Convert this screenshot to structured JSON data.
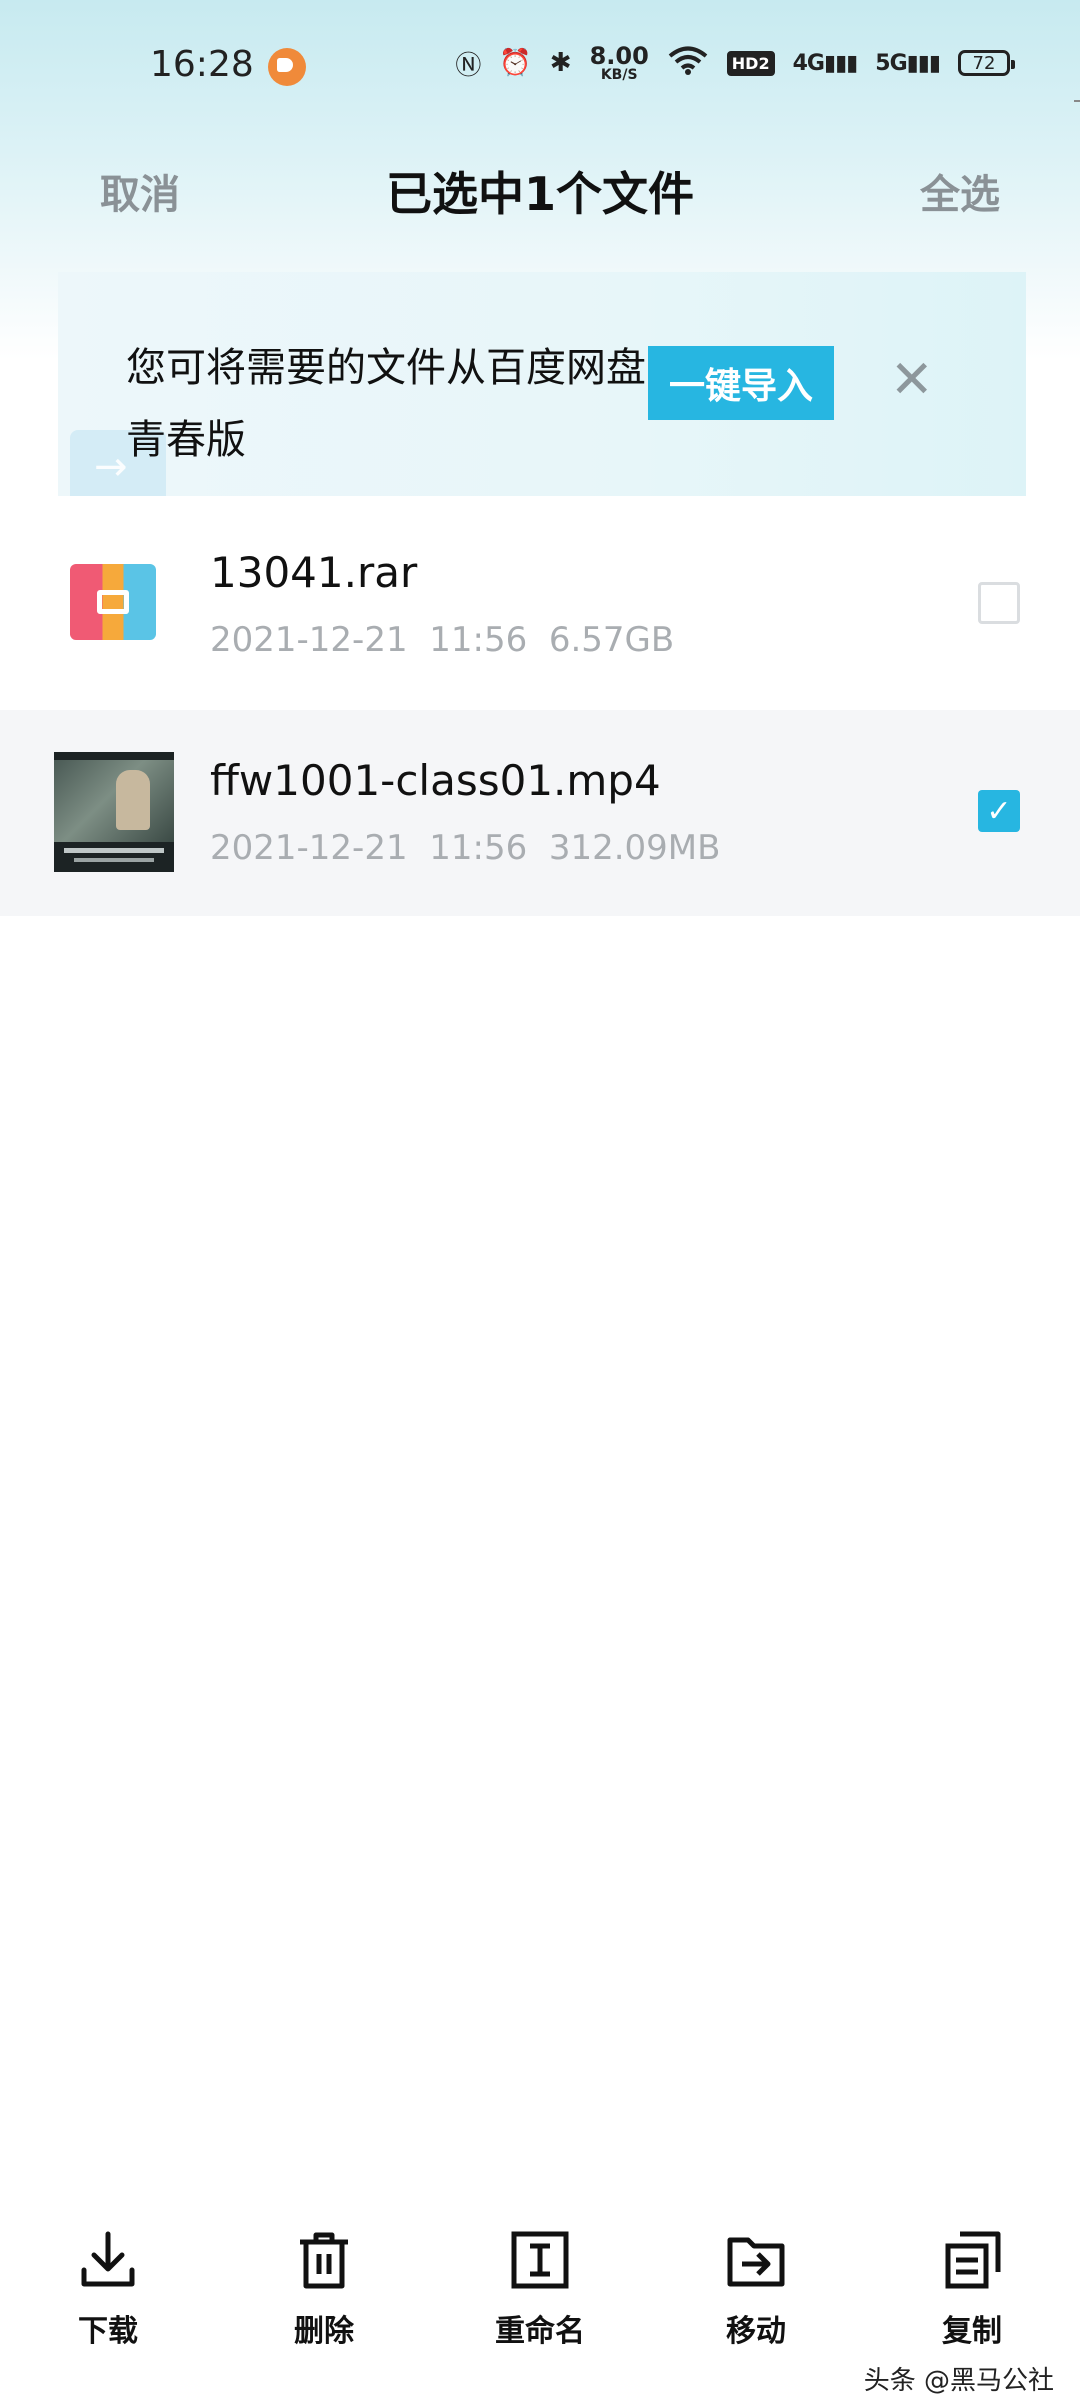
{
  "status_bar": {
    "time": "16:28",
    "net_speed_value": "8.00",
    "net_speed_unit": "KB/S",
    "hd_label": "HD2",
    "signal_1": "4G",
    "signal_2": "5G",
    "battery": "72",
    "icons": [
      "app-notification-icon",
      "nfc-icon",
      "alarm-icon",
      "bluetooth-icon",
      "wifi-icon",
      "signal-icon",
      "battery-icon"
    ]
  },
  "header": {
    "cancel_label": "取消",
    "title": "已选中1个文件",
    "select_all_label": "全选"
  },
  "banner": {
    "text": "您可将需要的文件从百度网盘导入青春版",
    "button_label": "一键导入",
    "close_icon": "close-icon"
  },
  "files": [
    {
      "name": "13041.rar",
      "date": "2021-12-21",
      "time": "11:56",
      "size": "6.57GB",
      "selected": false,
      "icon": "rar-archive-icon"
    },
    {
      "name": "ffw1001-class01.mp4",
      "date": "2021-12-21",
      "time": "11:56",
      "size": "312.09MB",
      "selected": true,
      "icon": "video-thumbnail"
    }
  ],
  "toolbar": {
    "download_label": "下载",
    "delete_label": "删除",
    "rename_label": "重命名",
    "move_label": "移动",
    "copy_label": "复制"
  },
  "watermark": "头条 @黑马公社",
  "colors": {
    "accent": "#27b6e1",
    "muted_text": "#a9adb1",
    "header_action": "#8a9196"
  }
}
